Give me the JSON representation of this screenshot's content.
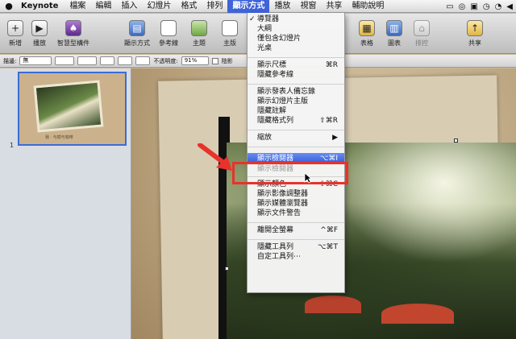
{
  "menubar": {
    "app": "Keynote",
    "items": [
      "檔案",
      "編輯",
      "插入",
      "幻燈片",
      "格式",
      "排列",
      "顯示方式",
      "播放",
      "視窗",
      "共享",
      "輔助說明"
    ],
    "active_item": "顯示方式"
  },
  "toolbar": {
    "new": "新增",
    "play": "播放",
    "smart_build": "智慧型構件",
    "view": "顯示方式",
    "guides": "參考線",
    "theme": "主題",
    "master": "主版",
    "table": "表格",
    "chart": "圖表",
    "arrange": "排控",
    "share": "共享"
  },
  "formatbar": {
    "stroke_label": "描邊:",
    "stroke_value": "無",
    "opacity_label": "不透明度:",
    "opacity_value": "91%",
    "shadow_label": "陰影"
  },
  "navigator": {
    "slide_number": "1",
    "slide_caption": "我 · 与樹与咖啡"
  },
  "view_menu": {
    "section1": [
      {
        "label": "導覽器",
        "checked": true
      },
      {
        "label": "大綱"
      },
      {
        "label": "僅包含幻燈片"
      },
      {
        "label": "光桌"
      }
    ],
    "section2": [
      {
        "label": "顯示尺標",
        "shortcut": "⌘R"
      },
      {
        "label": "隱藏參考線"
      }
    ],
    "section3": [
      {
        "label": "顯示發表人備忘錄"
      },
      {
        "label": "顯示幻燈片主版"
      },
      {
        "label": "隱藏註解"
      },
      {
        "label": "隱藏格式列",
        "shortcut": "⇧⌘R"
      }
    ],
    "zoom": {
      "label": "縮放",
      "submenu_arrow": "▶"
    },
    "highlighted": {
      "label": "顯示檢閱器",
      "shortcut": "⌥⌘I"
    },
    "hidden_under": "顯示檢閱器",
    "section5": [
      {
        "label": "顯示顏色",
        "shortcut": "⇧⌘C"
      },
      {
        "label": "顯示影像調整器"
      },
      {
        "label": "顯示媒體瀏覽器"
      },
      {
        "label": "顯示文件警告"
      }
    ],
    "fullscreen": {
      "label": "離開全螢幕",
      "shortcut": "^⌘F"
    },
    "section7": [
      {
        "label": "隱藏工具列",
        "shortcut": "⌥⌘T"
      },
      {
        "label": "自定工具列⋯"
      }
    ]
  },
  "colors": {
    "highlight_red": "#e8322b",
    "menu_blue": "#3f63d8"
  }
}
